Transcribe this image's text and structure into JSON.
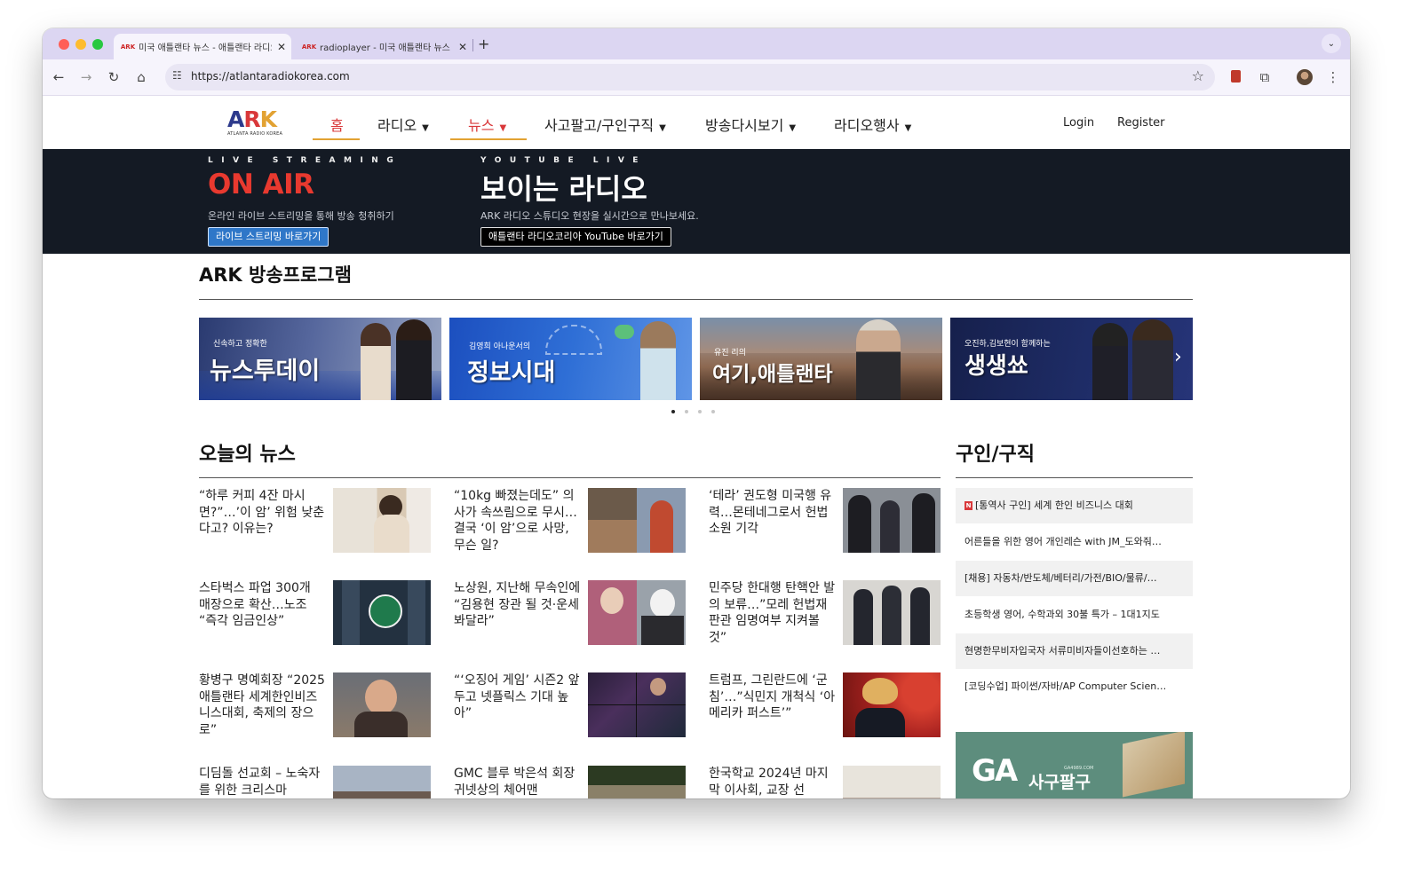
{
  "browser": {
    "tabs": [
      {
        "title": "미국 애틀랜타 뉴스 - 애틀랜타 라디오",
        "favicon": "ARK"
      },
      {
        "title": "radioplayer - 미국 애틀랜타 뉴스",
        "favicon": "ARK"
      }
    ],
    "url": "https://atlantaradiokorea.com"
  },
  "site": {
    "logo": {
      "text": "ARK",
      "subtitle": "ATLANTA RADIO KOREA"
    },
    "nav": [
      {
        "label": "홈",
        "has_caret": false,
        "active": true
      },
      {
        "label": "라디오",
        "has_caret": true,
        "active": false
      },
      {
        "label": "뉴스",
        "has_caret": true,
        "active": true
      },
      {
        "label": "사고팔고/구인구직",
        "has_caret": true,
        "active": false
      },
      {
        "label": "방송다시보기",
        "has_caret": true,
        "active": false
      },
      {
        "label": "라디오행사",
        "has_caret": true,
        "active": false
      }
    ],
    "auth": {
      "login": "Login",
      "register": "Register"
    }
  },
  "live": {
    "streaming": {
      "kicker": "LIVE STREAMING",
      "title": "ON AIR",
      "desc": "온라인 라이브 스트리밍을 통해 방송 청취하기",
      "button": "라이브 스트리밍 바로가기"
    },
    "youtube": {
      "kicker": "YOUTUBE LIVE",
      "title": "보이는 라디오",
      "desc": "ARK 라디오 스튜디오 현장을 실시간으로 만나보세요.",
      "button": "애틀랜타 라디오코리아 YouTube 바로가기"
    }
  },
  "programs": {
    "title": "ARK 방송프로그램",
    "cards": [
      {
        "small": "신속하고 정확한",
        "big": "뉴스투데이"
      },
      {
        "small": "김영희 아나운서의",
        "big": "정보시대"
      },
      {
        "small": "유진 리의",
        "big": "여기,애틀랜타"
      },
      {
        "small": "오진하,김보현이 함께하는",
        "big": "생생쑈"
      }
    ],
    "slider_dots": 4,
    "active_dot": 0
  },
  "news": {
    "title": "오늘의 뉴스",
    "items": [
      {
        "text": "“하루 커피 4잔 마시면?”…’이 암’ 위험 낮춘다고? 이유는?",
        "thumb": "woman-coffee-photo"
      },
      {
        "text": "“10kg 빠졌는데도” 의사가 속쓰림으로 무시…결국 ‘이 암’으로 사망, 무슨 일?",
        "thumb": "group-photo"
      },
      {
        "text": "‘테라’ 권도형 미국행 유력…몬테네그로서 헌법소원 기각",
        "thumb": "police-escort-photo"
      },
      {
        "text": "스타벅스 파업 300개 매장으로 확산…노조 “즉각 임금인상”",
        "thumb": "starbucks-apron-photo"
      },
      {
        "text": "노상원, 지난해 무속인에 “김용현 장관 될 것·운세 봐달라”",
        "thumb": "two-portraits-photo"
      },
      {
        "text": "민주당 한대행 탄핵안 발의 보류…”모레 헌법재판관 임명여부 지켜볼 것”",
        "thumb": "politicians-photo"
      },
      {
        "text": "황병구 명예회장 “2025 애틀랜타 세계한인비즈니스대회, 축제의 장으로”",
        "thumb": "man-smiling-photo"
      },
      {
        "text": "“‘오징어 게임’ 시즌2 앞두고 넷플릭스 기대 높아”",
        "thumb": "squid-game-photo"
      },
      {
        "text": "트럼프, 그린란드에 ‘군침’…”식민지 개척식 ‘아메리카 퍼스트’”",
        "thumb": "trump-photo"
      },
      {
        "text": "디딤돌 선교회 – 노숙자를 위한 크리스마",
        "thumb": "crowd-outdoor-photo"
      },
      {
        "text": "GMC 블루 박은석 회장 귀넷상의 체어맨",
        "thumb": "gwinnett-chamber-photo"
      },
      {
        "text": "한국학교 2024년 마지막 이사회, 교장 선",
        "thumb": "meeting-photo"
      }
    ]
  },
  "jobs": {
    "title": "구인/구직",
    "items": [
      {
        "text": "[통역사 구인] 세계 한인 비즈니스 대회",
        "badge": "N"
      },
      {
        "text": "어른들을 위한 영어 개인레슨 with JM_도와줘…",
        "badge": ""
      },
      {
        "text": "[채용] 자동차/반도체/베터리/가전/BIO/물류/…",
        "badge": ""
      },
      {
        "text": "초등학생 영어, 수학과외 30불 특가 – 1대1지도",
        "badge": ""
      },
      {
        "text": "현명한무비자입국자 서류미비자들이선호하는 …",
        "badge": ""
      },
      {
        "text": "[코딩수업] 파이썬/자바/AP Computer Scien…",
        "badge": ""
      }
    ],
    "ad": {
      "logo": "GA",
      "text": "사구팔구",
      "url": "GA4989.COM"
    }
  },
  "colors": {
    "accent_red": "#d9383a",
    "nav_underline": "#e2a233",
    "banner_bg": "#141a24",
    "tab_strip": "#dcd6f2"
  }
}
